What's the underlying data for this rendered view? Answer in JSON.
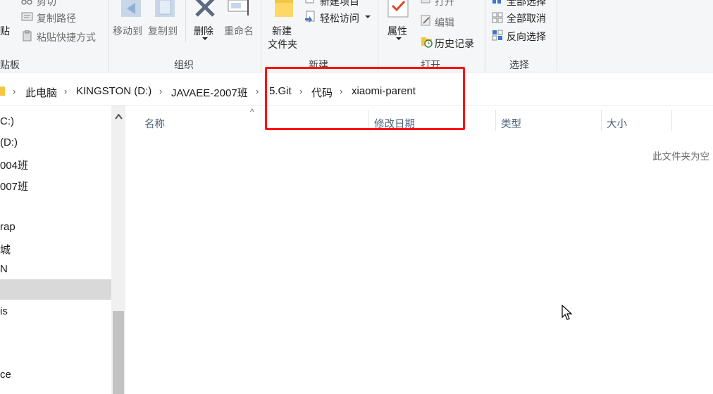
{
  "ribbon": {
    "clipboard": {
      "paste_label": "贴",
      "cut_label": "剪切",
      "copy_path_label": "复制路径",
      "paste_shortcut_label": "粘贴快捷方式",
      "group_label": "贴板"
    },
    "organize": {
      "move_to_label": "移动到",
      "copy_to_label": "复制到",
      "delete_label": "删除",
      "rename_label": "重命名",
      "group_label": "组织"
    },
    "new": {
      "new_folder_label_1": "新建",
      "new_folder_label_2": "文件夹",
      "new_item_label": "新建项目",
      "easy_access_label": "轻松访问",
      "group_label": "新建"
    },
    "open": {
      "properties_label": "属性",
      "open_label": "打开",
      "edit_label": "编辑",
      "history_label": "历史记录",
      "group_label": "打开"
    },
    "select": {
      "select_all_label": "全部选择",
      "select_none_label": "全部取消",
      "invert_selection_label": "反向选择",
      "group_label": "选择"
    }
  },
  "address": {
    "crumbs": [
      "此电脑",
      "KINGSTON (D:)",
      "JAVAEE-2007班",
      "5.Git",
      "代码",
      "xiaomi-parent"
    ]
  },
  "nav": {
    "items": [
      "C:)",
      "(D:)",
      "004班",
      "007班",
      "rap",
      "城",
      "N",
      "is",
      "ce"
    ]
  },
  "filelist": {
    "columns": [
      "名称",
      "修改日期",
      "类型",
      "大小"
    ],
    "sort_indicator": "^",
    "empty_message": "此文件夹为空"
  },
  "colors": {
    "highlight": "#ff1010",
    "ribbon_bg": "#f5f6f7",
    "column_text": "#4c607a",
    "nav_selected": "#d9d9d9"
  }
}
